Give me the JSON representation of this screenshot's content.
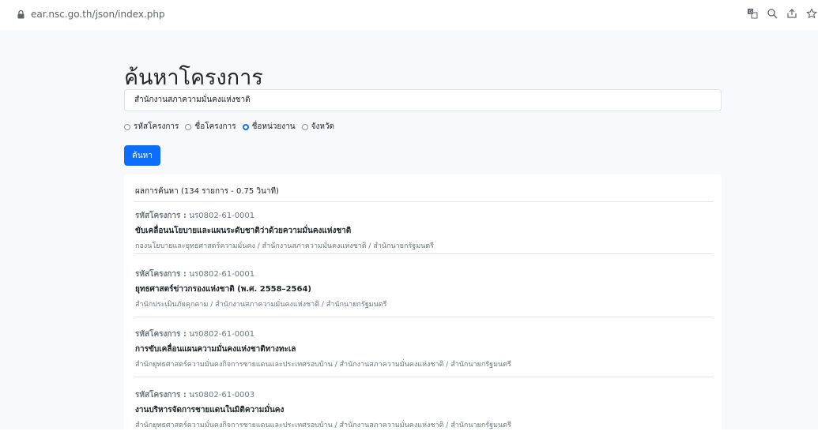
{
  "browser": {
    "url": "ear.nsc.go.th/json/index.php",
    "icons": [
      "lock-icon",
      "translate-icon",
      "zoom-icon",
      "share-icon",
      "star-icon"
    ]
  },
  "search": {
    "title": "ค้นหาโครงการ",
    "query": "สำนักงานสภาความมั่นคงแห่งชาติ",
    "options": [
      {
        "label": "รหัสโครงการ",
        "checked": false
      },
      {
        "label": "ชื่อโครงการ",
        "checked": false
      },
      {
        "label": "ชื่อหน่วยงาน",
        "checked": true
      },
      {
        "label": "จังหวัด",
        "checked": false
      }
    ],
    "button_label": "ค้นหา",
    "accent_color": "#0d6efd"
  },
  "results": {
    "summary": "ผลการค้นหา (134 รายการ - 0.75 วินาที)",
    "code_label": "รหัสโครงการ :",
    "items": [
      {
        "code": "นร0802-61-0001",
        "name": "ขับเคลื่อนนโยบายและแผนระดับชาติว่าด้วยความมั่นคงแห่งชาติ",
        "path": "กองนโยบายและยุทธศาสตร์ความมั่นคง / สำนักงานสภาความมั่นคงแห่งชาติ / สำนักนายกรัฐมนตรี"
      },
      {
        "code": "นร0802-61-0001",
        "name": "ยุทธศาสตร์ข่าวกรองแห่งชาติ (พ.ศ. 2558–2564)",
        "path": "สำนักประเมินภัยคุกคาม / สำนักงานสภาความมั่นคงแห่งชาติ / สำนักนายกรัฐมนตรี"
      },
      {
        "code": "นร0802-61-0001",
        "name": "การขับเคลื่อนแผนความมั่นคงแห่งชาติทางทะเล",
        "path": "สำนักยุทธศาสตร์ความมั่นคงกิจการชายแดนและประเทศรอบบ้าน / สำนักงานสภาความมั่นคงแห่งชาติ / สำนักนายกรัฐมนตรี"
      },
      {
        "code": "นร0802-61-0003",
        "name": "งานบริหารจัดการชายแดนในมิติความมั่นคง",
        "path": "สำนักยุทธศาสตร์ความมั่นคงกิจการชายแดนและประเทศรอบบ้าน / สำนักงานสภาความมั่นคงแห่งชาติ / สำนักนายกรัฐมนตรี"
      }
    ]
  }
}
